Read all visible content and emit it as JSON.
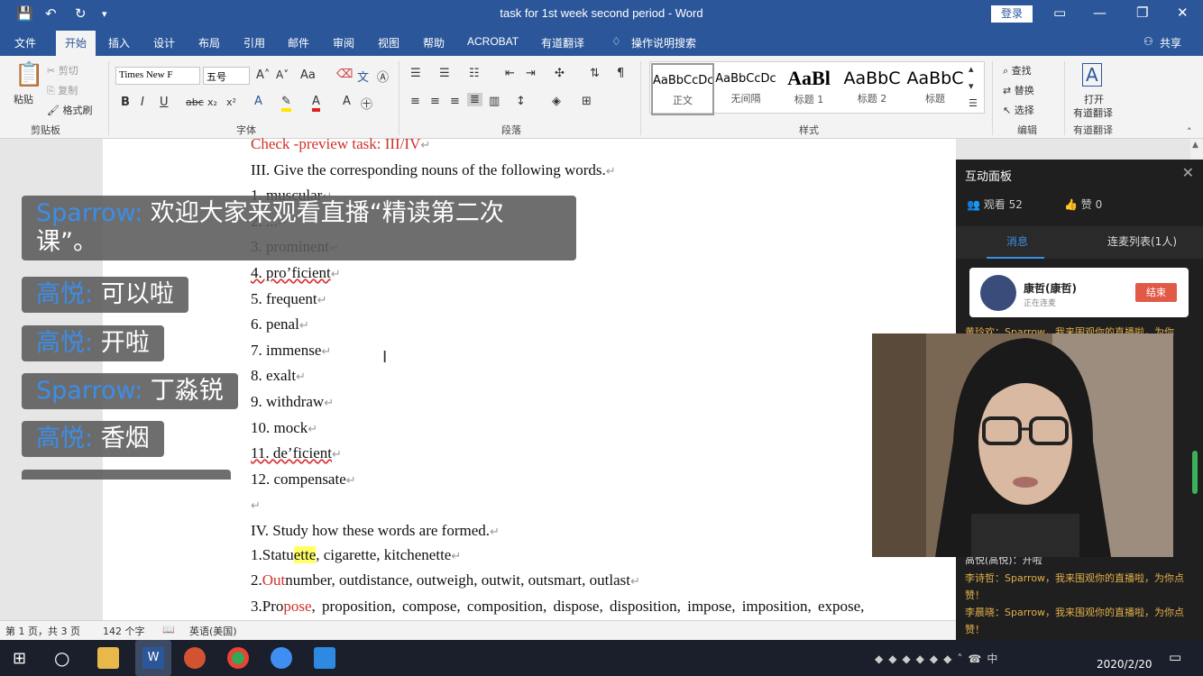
{
  "window": {
    "title": "task for 1st week second period - Word",
    "login_label": "登录"
  },
  "tabs": [
    "文件",
    "开始",
    "插入",
    "设计",
    "布局",
    "引用",
    "邮件",
    "审阅",
    "视图",
    "帮助",
    "ACROBAT",
    "有道翻译",
    "操作说明搜索"
  ],
  "share_label": "共享",
  "ribbon": {
    "clipboard": {
      "paste": "粘贴",
      "cut": "剪切",
      "copy": "复制",
      "format_painter": "格式刷",
      "label": "剪贴板"
    },
    "font": {
      "font_name": "Times New F",
      "font_size": "五号",
      "case": "Aa",
      "label": "字体"
    },
    "paragraph": {
      "label": "段落"
    },
    "styles": {
      "items": [
        {
          "sample": "AaBbCcDc",
          "name": "正文"
        },
        {
          "sample": "AaBbCcDc",
          "name": "无间隔"
        },
        {
          "sample": "AaBl",
          "name": "标题 1"
        },
        {
          "sample": "AaBbC",
          "name": "标题 2"
        },
        {
          "sample": "AaBbC",
          "name": "标题"
        }
      ],
      "label": "样式"
    },
    "editing": {
      "find": "查找",
      "replace": "替换",
      "select": "选择",
      "label": "编辑"
    },
    "youdao": {
      "open": "打开",
      "open2": "有道翻译",
      "label": "有道翻译"
    }
  },
  "document": {
    "lines": [
      {
        "kind": "red",
        "text": "Check -preview task: III/IV"
      },
      {
        "kind": "plain",
        "text": "III. Give the corresponding nouns of the following words."
      },
      {
        "kind": "plain",
        "text": "1. muscular"
      },
      {
        "kind": "plain",
        "text": "2. ..."
      },
      {
        "kind": "plain",
        "text": "3. prominent"
      },
      {
        "kind": "plain",
        "text": "4. pro’ficient"
      },
      {
        "kind": "plain",
        "text": "5. frequent"
      },
      {
        "kind": "plain",
        "text": "6. penal"
      },
      {
        "kind": "plain",
        "text": "7. immense"
      },
      {
        "kind": "plain",
        "text": "8. exalt"
      },
      {
        "kind": "plain",
        "text": "9. withdraw"
      },
      {
        "kind": "plain",
        "text": "10. mock"
      },
      {
        "kind": "plain",
        "text": "11. de’ficient"
      },
      {
        "kind": "plain",
        "text": "12. compensate"
      },
      {
        "kind": "plain",
        "text": ""
      },
      {
        "kind": "plain",
        "text": "IV. Study how these words are formed."
      }
    ],
    "line16": {
      "a": "1.Statu",
      "b": "ette",
      "c": ", cigarette, kitchenette"
    },
    "line17": {
      "a": "2.",
      "b": "Out",
      "c": "number, outdistance, outweigh, outwit, outsmart, outlast"
    },
    "line18": {
      "a": "3.Pro",
      "b": "pose",
      "c": ", proposition, compose, composition, dispose, disposition, impose, imposition, expose,"
    }
  },
  "status": {
    "pages": "第 1 页，共 3 页",
    "words": "142 个字",
    "lang": "英语(美国)"
  },
  "panel": {
    "title": "互动面板",
    "viewers": "观看 52",
    "likes": "赞 0",
    "tab_messages": "消息",
    "tab_list": "连麦列表(1人)",
    "card_name": "康哲(康哲)",
    "card_status": "正在连麦",
    "end_label": "结束",
    "messages": [
      "黄玲欢：Sparrow，我来围观你的直播啦，为你",
      "高悦(高悦)：开啦",
      "李诗哲：Sparrow，我来围观你的直播啦，为你点赞！",
      "李晨晓：Sparrow，我来围观你的直播啦，为你点赞！"
    ]
  },
  "chat": [
    {
      "who": "Sparrow:",
      "text": " 欢迎大家来观看直播“精读第二次课”。"
    },
    {
      "who": "高悦:",
      "text": " 可以啦"
    },
    {
      "who": "高悦:",
      "text": " 开啦"
    },
    {
      "who": "Sparrow:",
      "text": " 丁淼锐"
    },
    {
      "who": "高悦:",
      "text": " 香烟"
    }
  ],
  "taskbar": {
    "date": "2020/2/20"
  },
  "colors": {
    "word_blue": "#2b579a",
    "chat_name": "#3b8ee8",
    "red_text": "#d0302a",
    "highlight": "#ffff66"
  }
}
